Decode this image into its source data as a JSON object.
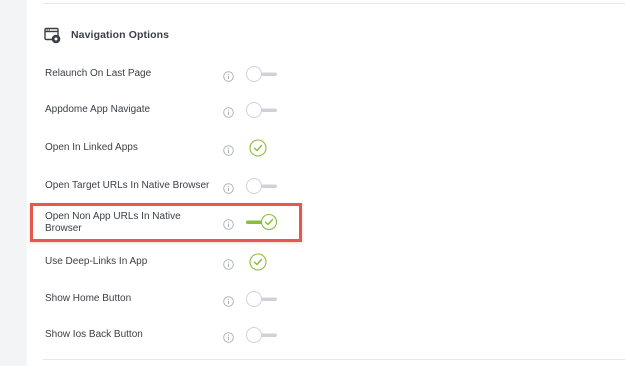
{
  "section": {
    "title": "Navigation Options",
    "icon": "browser-window-gear-icon"
  },
  "colors": {
    "accent_green": "#8cbc3f",
    "highlight_red": "#e8574a",
    "toggle_off_track": "#cfd3d8"
  },
  "options": [
    {
      "label": "Relaunch On Last Page",
      "state": "off"
    },
    {
      "label": "Appdome App Navigate",
      "state": "off"
    },
    {
      "label": "Open In Linked Apps",
      "state": "checked"
    },
    {
      "label": "Open Target URLs In Native Browser",
      "state": "off"
    },
    {
      "label": "Open Non App URLs In Native Browser",
      "state": "on",
      "highlighted": true
    },
    {
      "label": "Use Deep-Links In App",
      "state": "checked"
    },
    {
      "label": "Show Home Button",
      "state": "off"
    },
    {
      "label": "Show Ios Back Button",
      "state": "off"
    }
  ]
}
